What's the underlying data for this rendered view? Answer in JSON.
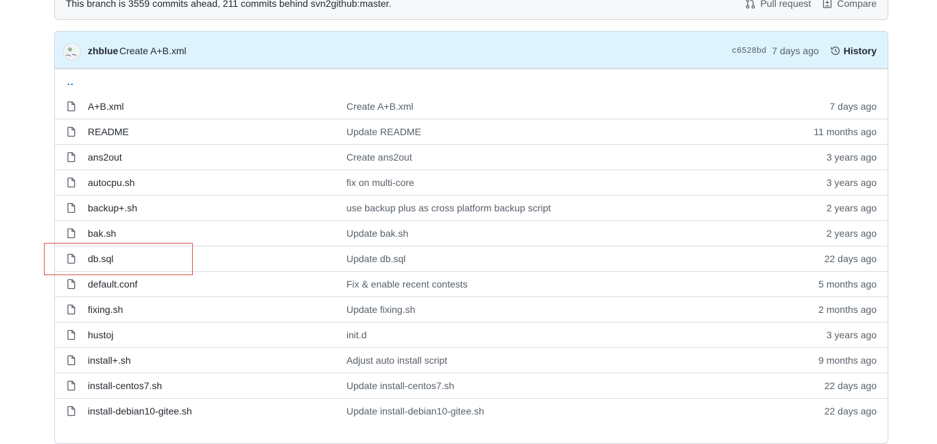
{
  "branch_bar": {
    "text": "This branch is 3559 commits ahead, 211 commits behind svn2github:master.",
    "pull_request_label": "Pull request",
    "compare_label": "Compare"
  },
  "commit": {
    "author": "zhblue",
    "message": "Create A+B.xml",
    "sha": "c6528bd",
    "age": "7 days ago",
    "history_label": "History"
  },
  "parent_link": "..",
  "files": [
    {
      "name": "A+B.xml",
      "message": "Create A+B.xml",
      "age": "7 days ago"
    },
    {
      "name": "README",
      "message": "Update README",
      "age": "11 months ago"
    },
    {
      "name": "ans2out",
      "message": "Create ans2out",
      "age": "3 years ago"
    },
    {
      "name": "autocpu.sh",
      "message": "fix on multi-core",
      "age": "3 years ago"
    },
    {
      "name": "backup+.sh",
      "message": "use backup plus as cross platform backup script",
      "age": "2 years ago"
    },
    {
      "name": "bak.sh",
      "message": "Update bak.sh",
      "age": "2 years ago"
    },
    {
      "name": "db.sql",
      "message": "Update db.sql",
      "age": "22 days ago"
    },
    {
      "name": "default.conf",
      "message": "Fix & enable recent contests",
      "age": "5 months ago"
    },
    {
      "name": "fixing.sh",
      "message": "Update fixing.sh",
      "age": "2 months ago"
    },
    {
      "name": "hustoj",
      "message": "init.d",
      "age": "3 years ago"
    },
    {
      "name": "install+.sh",
      "message": "Adjust auto install script",
      "age": "9 months ago"
    },
    {
      "name": "install-centos7.sh",
      "message": "Update install-centos7.sh",
      "age": "22 days ago"
    },
    {
      "name": "install-debian10-gitee.sh",
      "message": "Update install-debian10-gitee.sh",
      "age": "22 days ago"
    }
  ],
  "colors": {
    "header_bg": "#ddf4ff",
    "highlight": "#d9534f",
    "link": "#0969da"
  }
}
